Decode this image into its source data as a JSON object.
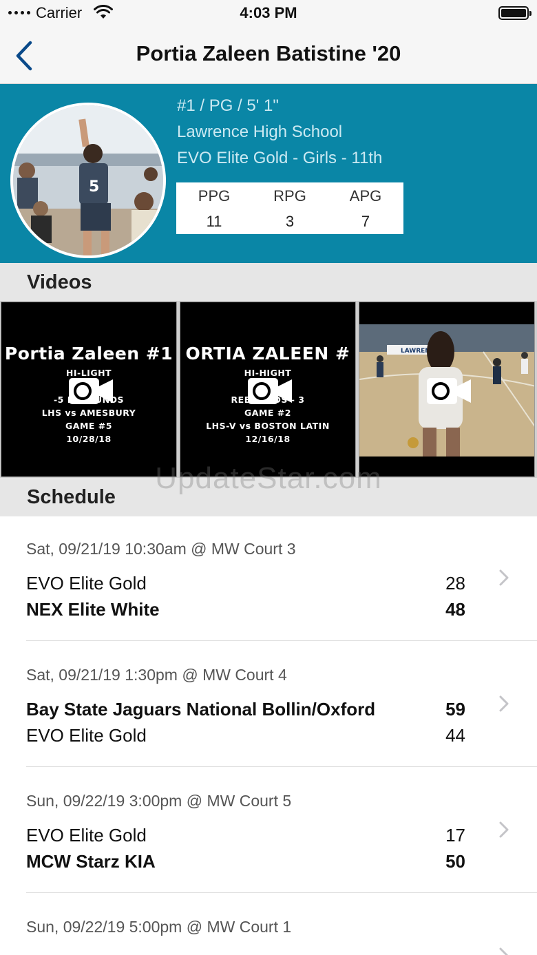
{
  "status_bar": {
    "carrier": "Carrier",
    "time": "4:03 PM"
  },
  "nav": {
    "title": "Portia Zaleen Batistine '20"
  },
  "profile": {
    "position_line": "#1 / PG / 5' 1\"",
    "school": "Lawrence High School",
    "team": "EVO Elite Gold - Girls - 11th",
    "stats": [
      {
        "label": "PPG",
        "value": "11"
      },
      {
        "label": "RPG",
        "value": "3"
      },
      {
        "label": "APG",
        "value": "7"
      }
    ]
  },
  "sections": {
    "videos": "Videos",
    "schedule": "Schedule"
  },
  "videos": [
    {
      "title": "Portia Zaleen #1",
      "lines": [
        "HI-LIGHT",
        "",
        "-5 REBOUNDS",
        "LHS vs AMESBURY",
        "GAME #5",
        "10/28/18"
      ]
    },
    {
      "title": "ORTIA ZALEEN #",
      "lines": [
        "HI-HIGHT",
        "P 5",
        "REBOUNDS - 3",
        "GAME #2",
        "LHS-V vs BOSTON LATIN",
        "12/16/18"
      ]
    },
    {
      "title": "",
      "lines": [],
      "banner": "LAWREN"
    }
  ],
  "watermark": "UpdateStar.com",
  "schedule": [
    {
      "date": "Sat, 09/21/19 10:30am @ MW Court 3",
      "team1": "EVO Elite Gold",
      "score1": "28",
      "team2": "NEX Elite White",
      "score2": "48",
      "winner": 2
    },
    {
      "date": "Sat, 09/21/19 1:30pm @ MW Court 4",
      "team1": "Bay State Jaguars National Bollin/Oxford",
      "score1": "59",
      "team2": "EVO Elite Gold",
      "score2": "44",
      "winner": 1
    },
    {
      "date": "Sun, 09/22/19 3:00pm @ MW Court 5",
      "team1": "EVO Elite Gold",
      "score1": "17",
      "team2": "MCW Starz KIA",
      "score2": "50",
      "winner": 2
    },
    {
      "date": "Sun, 09/22/19 5:00pm @ MW Court 1",
      "team1": "",
      "score1": "",
      "team2": "",
      "score2": "",
      "winner": 1
    }
  ],
  "colors": {
    "header_bg": "#0a86a6",
    "nav_tint": "#0a4a8a",
    "section_bg": "#e6e6e6"
  }
}
